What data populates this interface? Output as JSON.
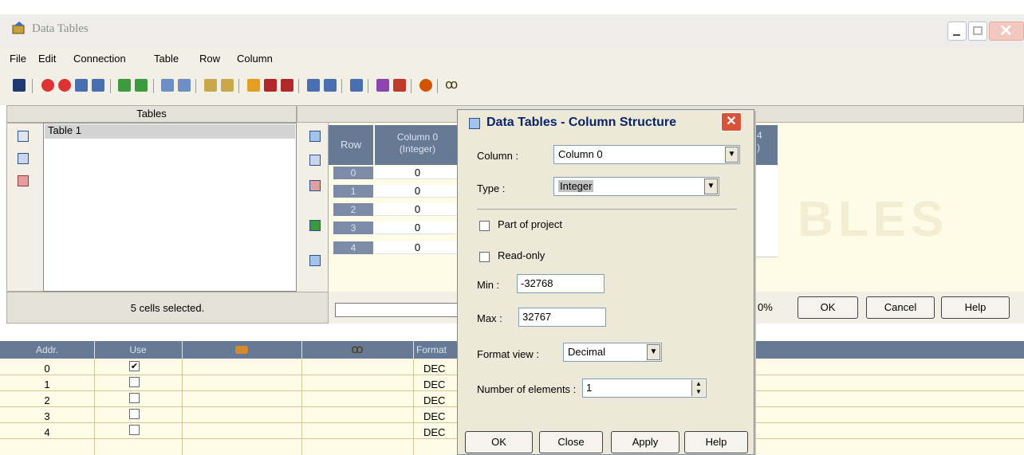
{
  "window": {
    "title": "Data Tables"
  },
  "menu": [
    "File",
    "Edit",
    "Connection",
    "Table",
    "Row",
    "Column"
  ],
  "tables_panel": {
    "header": "Tables",
    "items": [
      "Table 1"
    ]
  },
  "grid": {
    "row_header": "Row",
    "column_header_line1": "Column 0",
    "column_header_line2": "(Integer)",
    "rows": [
      {
        "num": "0",
        "value": "0"
      },
      {
        "num": "1",
        "value": "0"
      },
      {
        "num": "2",
        "value": "0"
      },
      {
        "num": "3",
        "value": "0"
      },
      {
        "num": "4",
        "value": "0"
      }
    ],
    "partial_column_header_line1": "4",
    "partial_column_header_line2": ")"
  },
  "status": {
    "selection": "5 cells selected.",
    "progress": "0%"
  },
  "main_buttons": {
    "ok": "OK",
    "cancel": "Cancel",
    "help": "Help"
  },
  "bottom_grid": {
    "headers": {
      "addr": "Addr.",
      "use": "Use",
      "format": "Format"
    },
    "rows": [
      {
        "addr": "0",
        "checked": true,
        "format": "DEC"
      },
      {
        "addr": "1",
        "checked": false,
        "format": "DEC"
      },
      {
        "addr": "2",
        "checked": false,
        "format": "DEC"
      },
      {
        "addr": "3",
        "checked": false,
        "format": "DEC"
      },
      {
        "addr": "4",
        "checked": false,
        "format": "DEC"
      }
    ]
  },
  "dialog": {
    "title": "Data Tables - Column Structure",
    "column_label": "Column :",
    "column_value": "Column 0",
    "type_label": "Type :",
    "type_value": "Integer",
    "part_of_project": "Part of project",
    "read_only": "Read-only",
    "min_label": "Min :",
    "min_value": "-32768",
    "max_label": "Max :",
    "max_value": "32767",
    "format_view_label": "Format view :",
    "format_view_value": "Decimal",
    "num_elements_label": "Number of elements :",
    "num_elements_value": "1",
    "buttons": {
      "ok": "OK",
      "close": "Close",
      "apply": "Apply",
      "help": "Help"
    }
  },
  "colors": {
    "header_blue": "#667a96",
    "grid_bg": "#fefbe6",
    "chrome": "#f1efe6"
  }
}
